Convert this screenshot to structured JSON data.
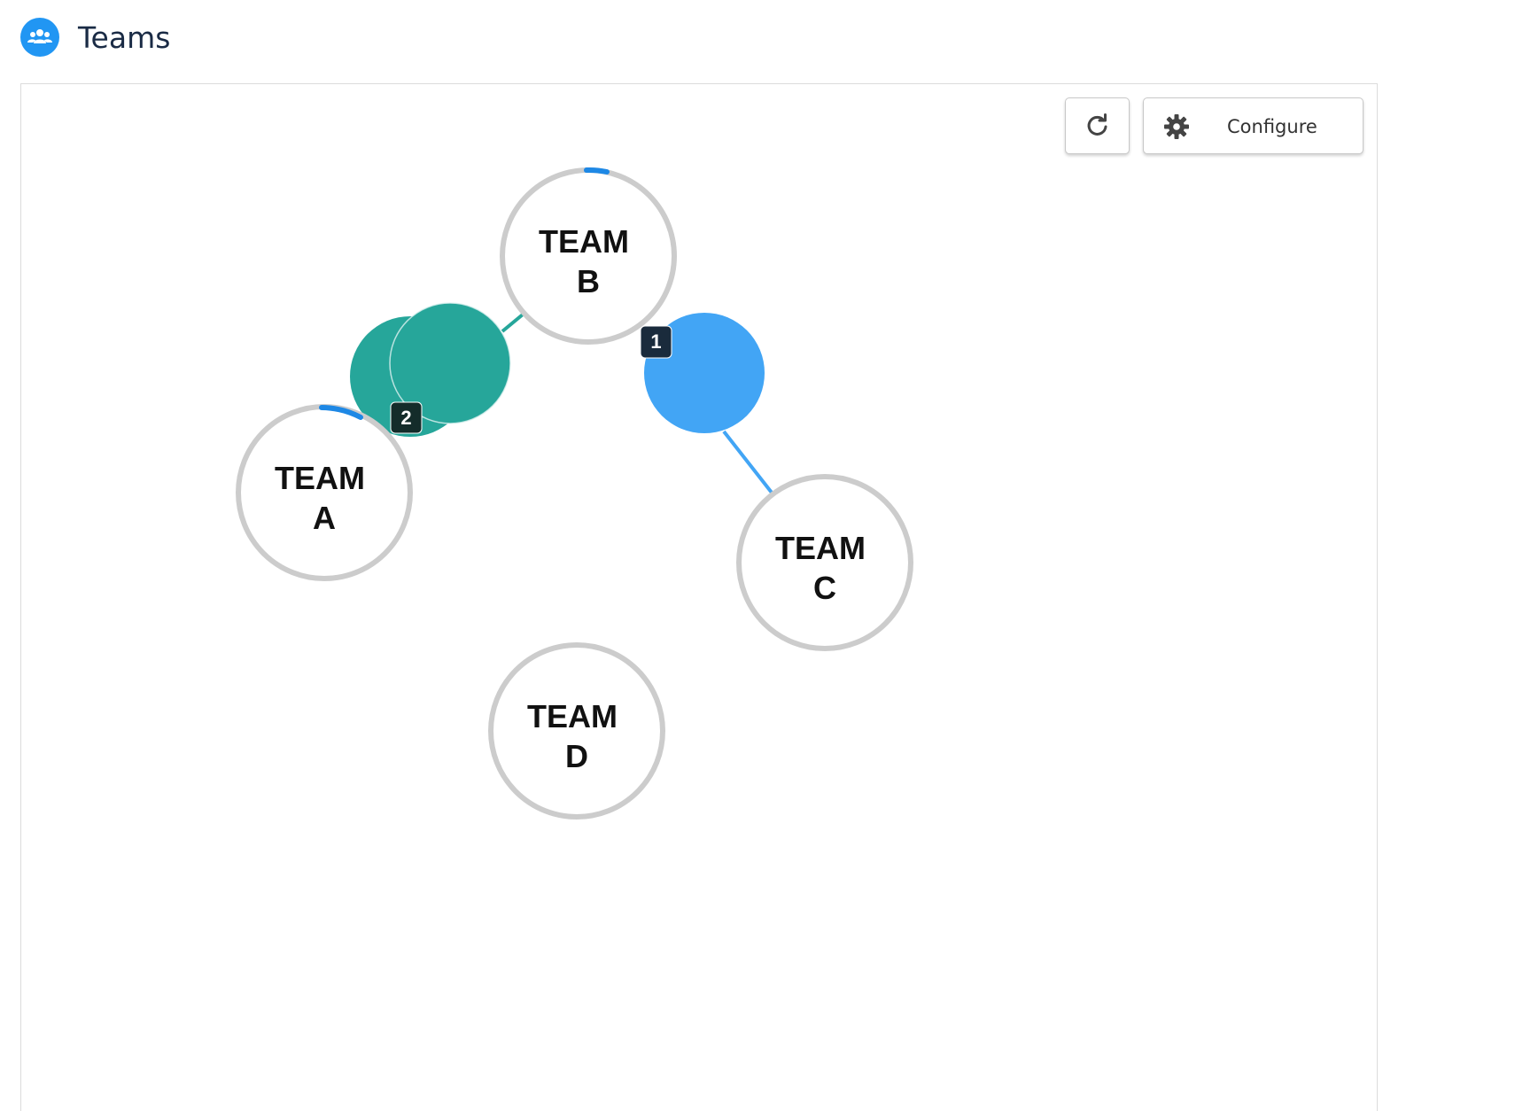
{
  "header": {
    "title": "Teams",
    "icon": "team-icon",
    "icon_color": "#2196f3"
  },
  "toolbar": {
    "refresh_icon": "refresh-icon",
    "configure_icon": "gear-icon",
    "configure_label": "Configure"
  },
  "graph": {
    "teams": [
      {
        "line1": "TEAM",
        "line2": "A"
      },
      {
        "line1": "TEAM",
        "line2": "B"
      },
      {
        "line1": "TEAM",
        "line2": "C"
      },
      {
        "line1": "TEAM",
        "line2": "D"
      }
    ],
    "links": [
      {
        "from": "TEAM A",
        "to": "TEAM B",
        "color": "#26a69a",
        "count": "2"
      },
      {
        "from": "TEAM B",
        "to": "TEAM C",
        "color": "#42a5f5",
        "count": "1"
      }
    ],
    "colors": {
      "node_ring": "#cccccc",
      "progress_arc": "#1e88e5",
      "badge": "#1a2b3c"
    }
  }
}
